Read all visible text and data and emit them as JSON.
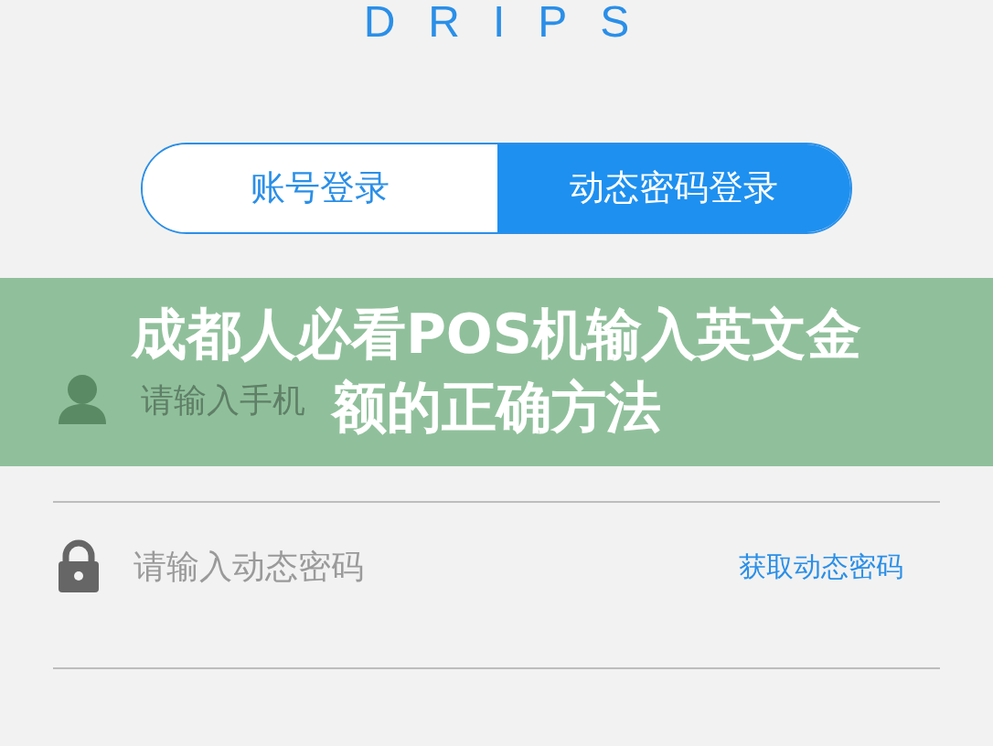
{
  "logo": "DRIPS",
  "tabs": [
    {
      "label": "账号登录",
      "selected": false
    },
    {
      "label": "动态密码登录",
      "selected": true
    }
  ],
  "fields": [
    {
      "kind": "phone",
      "placeholder": "请输入手机"
    },
    {
      "kind": "code",
      "placeholder": "请输入动态密码",
      "action": "获取动态密码"
    }
  ],
  "banner": {
    "lines": [
      "成都人必看POS机输入英文金",
      "额的正确方法"
    ]
  }
}
